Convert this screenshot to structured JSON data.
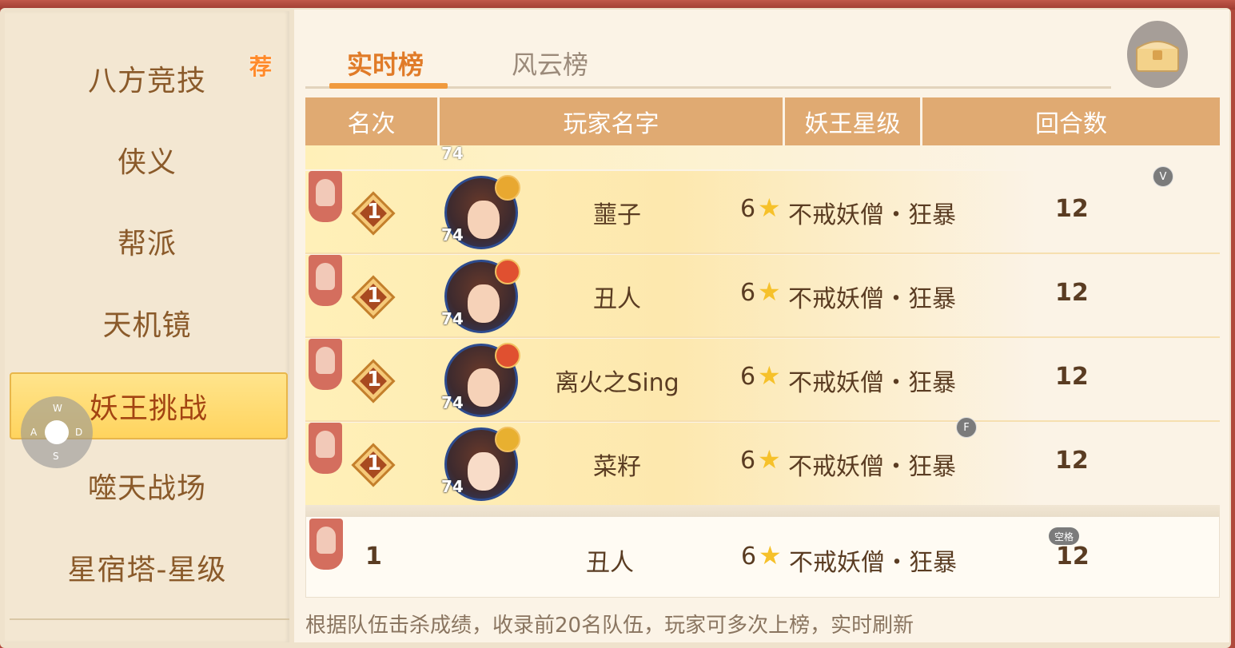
{
  "sidebar": {
    "items": [
      {
        "label": "八方竞技"
      },
      {
        "label": "侠义"
      },
      {
        "label": "帮派"
      },
      {
        "label": "天机镜"
      },
      {
        "label": "妖王挑战"
      },
      {
        "label": "噬天战场"
      },
      {
        "label": "星宿塔-星级"
      }
    ],
    "recommend_badge": "荐",
    "active_index": 4
  },
  "tabs": [
    {
      "label": "实时榜"
    },
    {
      "label": "风云榜"
    }
  ],
  "table": {
    "headers": [
      "名次",
      "玩家名字",
      "妖王星级",
      "回合数"
    ],
    "rows": [
      {
        "rank": "1",
        "level": "74",
        "name": "蘁子",
        "stars": "6",
        "boss": "不戒妖僧・狂暴",
        "rounds": "12"
      },
      {
        "rank": "1",
        "level": "74",
        "name": "丑人",
        "stars": "6",
        "boss": "不戒妖僧・狂暴",
        "rounds": "12"
      },
      {
        "rank": "1",
        "level": "74",
        "name": "离火之Sing",
        "stars": "6",
        "boss": "不戒妖僧・狂暴",
        "rounds": "12"
      },
      {
        "rank": "1",
        "level": "74",
        "name": "菜籽",
        "stars": "6",
        "boss": "不戒妖僧・狂暴",
        "rounds": "12"
      }
    ],
    "partial_top_level": "74"
  },
  "self_row": {
    "rank": "1",
    "name": "丑人",
    "stars": "6",
    "boss": "不戒妖僧・狂暴",
    "rounds": "12"
  },
  "footer_note": "根据队伍击杀成绩，收录前20名队伍，玩家可多次上榜，实时刷新",
  "keys": {
    "v": "V",
    "f": "F",
    "space": "空格"
  },
  "joystick": {
    "w": "W",
    "a": "A",
    "s": "S",
    "d": "D"
  },
  "icons": [
    "treasure-chest-icon",
    "player-tag-icon",
    "rank-medal-icon",
    "star-icon"
  ],
  "colors": {
    "accent": "#f09a3e",
    "header": "#e0aa72",
    "active_item": "#ffd45e"
  }
}
